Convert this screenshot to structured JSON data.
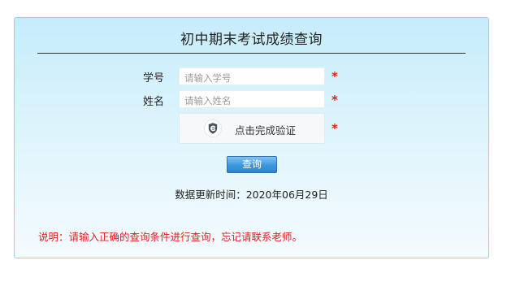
{
  "page": {
    "title": "初中期末考试成绩查询"
  },
  "form": {
    "student_id": {
      "label": "学号",
      "placeholder": "请输入学号",
      "required_mark": "*"
    },
    "name": {
      "label": "姓名",
      "placeholder": "请输入姓名",
      "required_mark": "*"
    },
    "captcha": {
      "text": "点击完成验证",
      "icon": "shield-check-icon",
      "required_mark": "*"
    },
    "submit_label": "查询"
  },
  "update_info": "数据更新时间：2020年06月29日",
  "note": "说明：请输入正确的查询条件进行查询，忘记请联系老师。",
  "colors": {
    "required": "#e02020",
    "note": "#e02020",
    "button": "#3c97de",
    "panel_border": "#8fd3ea"
  }
}
